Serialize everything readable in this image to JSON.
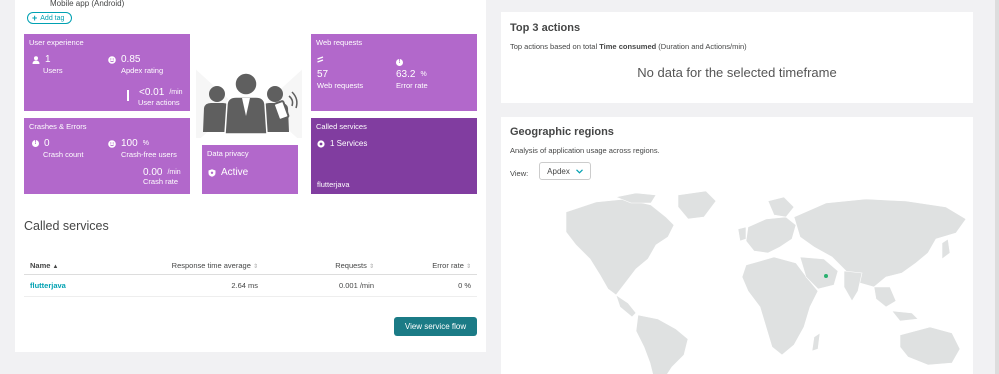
{
  "app": {
    "name": "Mobile app (Android)",
    "add_tag": "Add tag"
  },
  "tiles": {
    "user_experience": {
      "title": "User experience",
      "users_value": "1",
      "users_label": "Users",
      "apdex_value": "0.85",
      "apdex_label": "Apdex rating",
      "actions_value": "<0.01",
      "actions_unit": "/min",
      "actions_label": "User actions"
    },
    "crashes": {
      "title": "Crashes & Errors",
      "crash_count_value": "0",
      "crash_count_label": "Crash count",
      "crash_free_value": "100",
      "crash_free_unit": "%",
      "crash_free_label": "Crash-free users",
      "crash_rate_value": "0.00",
      "crash_rate_unit": "/min",
      "crash_rate_label": "Crash rate"
    },
    "web_requests": {
      "title": "Web requests",
      "requests_value": "57",
      "requests_label": "Web requests",
      "error_value": "63.2",
      "error_unit": "%",
      "error_label": "Error rate"
    },
    "called_services": {
      "title": "Called services",
      "count": "1 Services",
      "service": "flutterjava"
    },
    "data_privacy": {
      "title": "Data privacy",
      "status": "Active"
    }
  },
  "called_services_section": {
    "title": "Called services",
    "columns": [
      "Name",
      "Response time average",
      "Requests",
      "Error rate"
    ],
    "rows": [
      {
        "name": "flutterjava",
        "response_time": "2.64 ms",
        "requests": "0.001 /min",
        "error_rate": "0 %"
      }
    ],
    "view_flow_button": "View service flow"
  },
  "top_actions": {
    "title": "Top 3 actions",
    "subtitle_pre": "Top actions based on total ",
    "subtitle_bold": "Time consumed",
    "subtitle_post": " (Duration and Actions/min)",
    "no_data": "No data for the selected timeframe"
  },
  "geo": {
    "title": "Geographic regions",
    "subtitle": "Analysis of application usage across regions.",
    "view_label": "View:",
    "view_value": "Apdex"
  },
  "colors": {
    "tile": "#b268cb",
    "tile_dark": "#813da0",
    "accent": "#00a1b2",
    "button": "#1b7b86"
  }
}
